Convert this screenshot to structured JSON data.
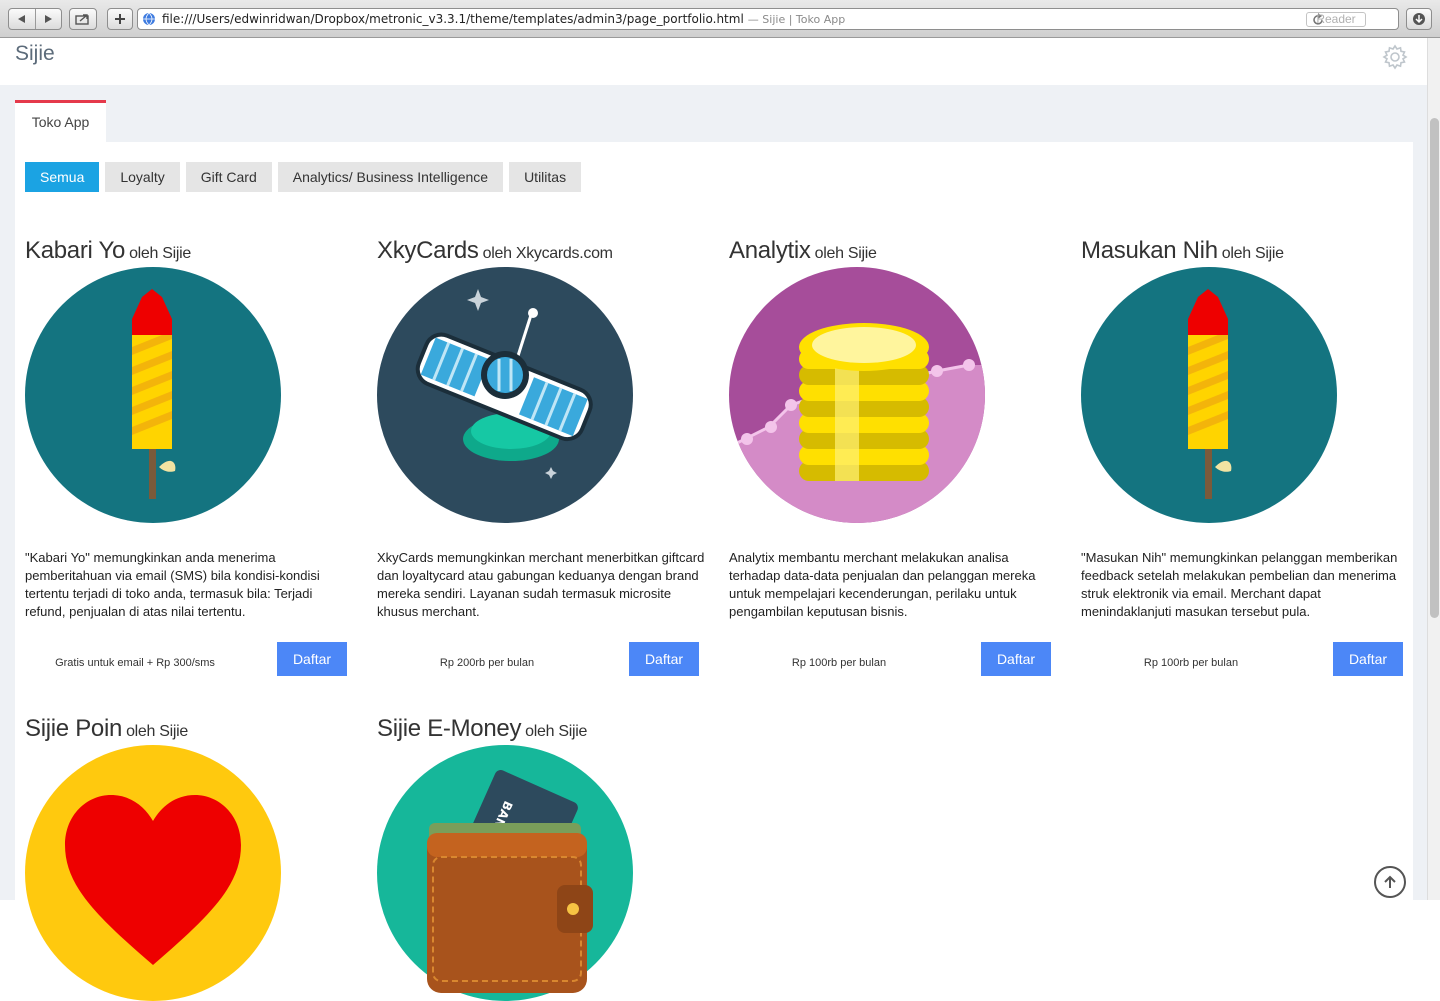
{
  "browser": {
    "url": "file:///Users/edwinridwan/Dropbox/metronic_v3.3.1/theme/templates/admin3/page_portfolio.html",
    "title_suffix": "— Sijie | Toko App",
    "reader_label": "Reader"
  },
  "header": {
    "brand": "Sijie"
  },
  "tab": {
    "label": "Toko App"
  },
  "filters": [
    "Semua",
    "Loyalty",
    "Gift Card",
    "Analytics/ Business Intelligence",
    "Utilitas"
  ],
  "apps": [
    {
      "name": "Kabari Yo",
      "by": "oleh Sijie",
      "description": "\"Kabari Yo\" memungkinkan anda menerima pemberitahuan via email (SMS) bila kondisi-kondisi tertentu terjadi di toko anda, termasuk bila: Terjadi refund, penjualan di atas nilai tertentu.",
      "price": "Gratis untuk email + Rp 300/sms",
      "button": "Daftar",
      "icon": "rocket-icon"
    },
    {
      "name": "XkyCards",
      "by": "oleh Xkycards.com",
      "description": "XkyCards memungkinkan merchant menerbitkan giftcard dan loyaltycard atau gabungan keduanya dengan brand mereka sendiri. Layanan sudah termasuk microsite khusus merchant.",
      "price": "Rp 200rb per bulan",
      "button": "Daftar",
      "icon": "satellite-icon"
    },
    {
      "name": "Analytix",
      "by": "oleh Sijie",
      "description": "Analytix membantu merchant melakukan analisa terhadap data-data penjualan dan pelanggan mereka untuk mempelajari kecenderungan, perilaku untuk pengambilan keputusan bisnis.",
      "price": "Rp 100rb per bulan",
      "button": "Daftar",
      "icon": "coins-icon"
    },
    {
      "name": "Masukan Nih",
      "by": "oleh Sijie",
      "description": "\"Masukan Nih\" memungkinkan pelanggan memberikan feedback setelah melakukan pembelian dan menerima struk elektronik via email. Merchant dapat menindaklanjuti masukan tersebut pula.",
      "price": "Rp 100rb per bulan",
      "button": "Daftar",
      "icon": "rocket-icon"
    },
    {
      "name": "Sijie Poin",
      "by": "oleh Sijie",
      "icon": "heart-icon"
    },
    {
      "name": "Sijie E-Money",
      "by": "oleh Sijie",
      "icon": "wallet-icon",
      "card_text": "BANK"
    }
  ],
  "colors": {
    "tab_accent": "#e5394b",
    "filter_active": "#1ba3e3",
    "button": "#4c87f7",
    "rocket_bg": "#147480",
    "satellite_bg": "#2d4a5d",
    "coins_bg": "#d58dc8",
    "heart_bg": "#ffc90e",
    "wallet_bg": "#16b79a"
  }
}
